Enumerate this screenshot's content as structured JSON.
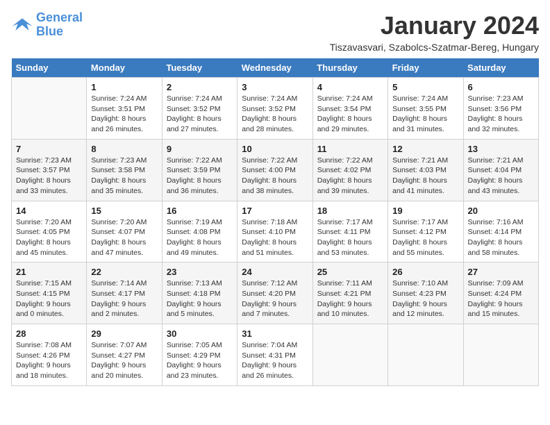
{
  "logo": {
    "line1": "General",
    "line2": "Blue"
  },
  "title": "January 2024",
  "location": "Tiszavasvari, Szabolcs-Szatmar-Bereg, Hungary",
  "days_of_week": [
    "Sunday",
    "Monday",
    "Tuesday",
    "Wednesday",
    "Thursday",
    "Friday",
    "Saturday"
  ],
  "weeks": [
    [
      {
        "day": "",
        "info": ""
      },
      {
        "day": "1",
        "sunrise": "7:24 AM",
        "sunset": "3:51 PM",
        "daylight": "8 hours and 26 minutes."
      },
      {
        "day": "2",
        "sunrise": "7:24 AM",
        "sunset": "3:52 PM",
        "daylight": "8 hours and 27 minutes."
      },
      {
        "day": "3",
        "sunrise": "7:24 AM",
        "sunset": "3:52 PM",
        "daylight": "8 hours and 28 minutes."
      },
      {
        "day": "4",
        "sunrise": "7:24 AM",
        "sunset": "3:54 PM",
        "daylight": "8 hours and 29 minutes."
      },
      {
        "day": "5",
        "sunrise": "7:24 AM",
        "sunset": "3:55 PM",
        "daylight": "8 hours and 31 minutes."
      },
      {
        "day": "6",
        "sunrise": "7:23 AM",
        "sunset": "3:56 PM",
        "daylight": "8 hours and 32 minutes."
      }
    ],
    [
      {
        "day": "7",
        "sunrise": "7:23 AM",
        "sunset": "3:57 PM",
        "daylight": "8 hours and 33 minutes."
      },
      {
        "day": "8",
        "sunrise": "7:23 AM",
        "sunset": "3:58 PM",
        "daylight": "8 hours and 35 minutes."
      },
      {
        "day": "9",
        "sunrise": "7:22 AM",
        "sunset": "3:59 PM",
        "daylight": "8 hours and 36 minutes."
      },
      {
        "day": "10",
        "sunrise": "7:22 AM",
        "sunset": "4:00 PM",
        "daylight": "8 hours and 38 minutes."
      },
      {
        "day": "11",
        "sunrise": "7:22 AM",
        "sunset": "4:02 PM",
        "daylight": "8 hours and 39 minutes."
      },
      {
        "day": "12",
        "sunrise": "7:21 AM",
        "sunset": "4:03 PM",
        "daylight": "8 hours and 41 minutes."
      },
      {
        "day": "13",
        "sunrise": "7:21 AM",
        "sunset": "4:04 PM",
        "daylight": "8 hours and 43 minutes."
      }
    ],
    [
      {
        "day": "14",
        "sunrise": "7:20 AM",
        "sunset": "4:05 PM",
        "daylight": "8 hours and 45 minutes."
      },
      {
        "day": "15",
        "sunrise": "7:20 AM",
        "sunset": "4:07 PM",
        "daylight": "8 hours and 47 minutes."
      },
      {
        "day": "16",
        "sunrise": "7:19 AM",
        "sunset": "4:08 PM",
        "daylight": "8 hours and 49 minutes."
      },
      {
        "day": "17",
        "sunrise": "7:18 AM",
        "sunset": "4:10 PM",
        "daylight": "8 hours and 51 minutes."
      },
      {
        "day": "18",
        "sunrise": "7:17 AM",
        "sunset": "4:11 PM",
        "daylight": "8 hours and 53 minutes."
      },
      {
        "day": "19",
        "sunrise": "7:17 AM",
        "sunset": "4:12 PM",
        "daylight": "8 hours and 55 minutes."
      },
      {
        "day": "20",
        "sunrise": "7:16 AM",
        "sunset": "4:14 PM",
        "daylight": "8 hours and 58 minutes."
      }
    ],
    [
      {
        "day": "21",
        "sunrise": "7:15 AM",
        "sunset": "4:15 PM",
        "daylight": "9 hours and 0 minutes."
      },
      {
        "day": "22",
        "sunrise": "7:14 AM",
        "sunset": "4:17 PM",
        "daylight": "9 hours and 2 minutes."
      },
      {
        "day": "23",
        "sunrise": "7:13 AM",
        "sunset": "4:18 PM",
        "daylight": "9 hours and 5 minutes."
      },
      {
        "day": "24",
        "sunrise": "7:12 AM",
        "sunset": "4:20 PM",
        "daylight": "9 hours and 7 minutes."
      },
      {
        "day": "25",
        "sunrise": "7:11 AM",
        "sunset": "4:21 PM",
        "daylight": "9 hours and 10 minutes."
      },
      {
        "day": "26",
        "sunrise": "7:10 AM",
        "sunset": "4:23 PM",
        "daylight": "9 hours and 12 minutes."
      },
      {
        "day": "27",
        "sunrise": "7:09 AM",
        "sunset": "4:24 PM",
        "daylight": "9 hours and 15 minutes."
      }
    ],
    [
      {
        "day": "28",
        "sunrise": "7:08 AM",
        "sunset": "4:26 PM",
        "daylight": "9 hours and 18 minutes."
      },
      {
        "day": "29",
        "sunrise": "7:07 AM",
        "sunset": "4:27 PM",
        "daylight": "9 hours and 20 minutes."
      },
      {
        "day": "30",
        "sunrise": "7:05 AM",
        "sunset": "4:29 PM",
        "daylight": "9 hours and 23 minutes."
      },
      {
        "day": "31",
        "sunrise": "7:04 AM",
        "sunset": "4:31 PM",
        "daylight": "9 hours and 26 minutes."
      },
      {
        "day": "",
        "info": ""
      },
      {
        "day": "",
        "info": ""
      },
      {
        "day": "",
        "info": ""
      }
    ]
  ]
}
